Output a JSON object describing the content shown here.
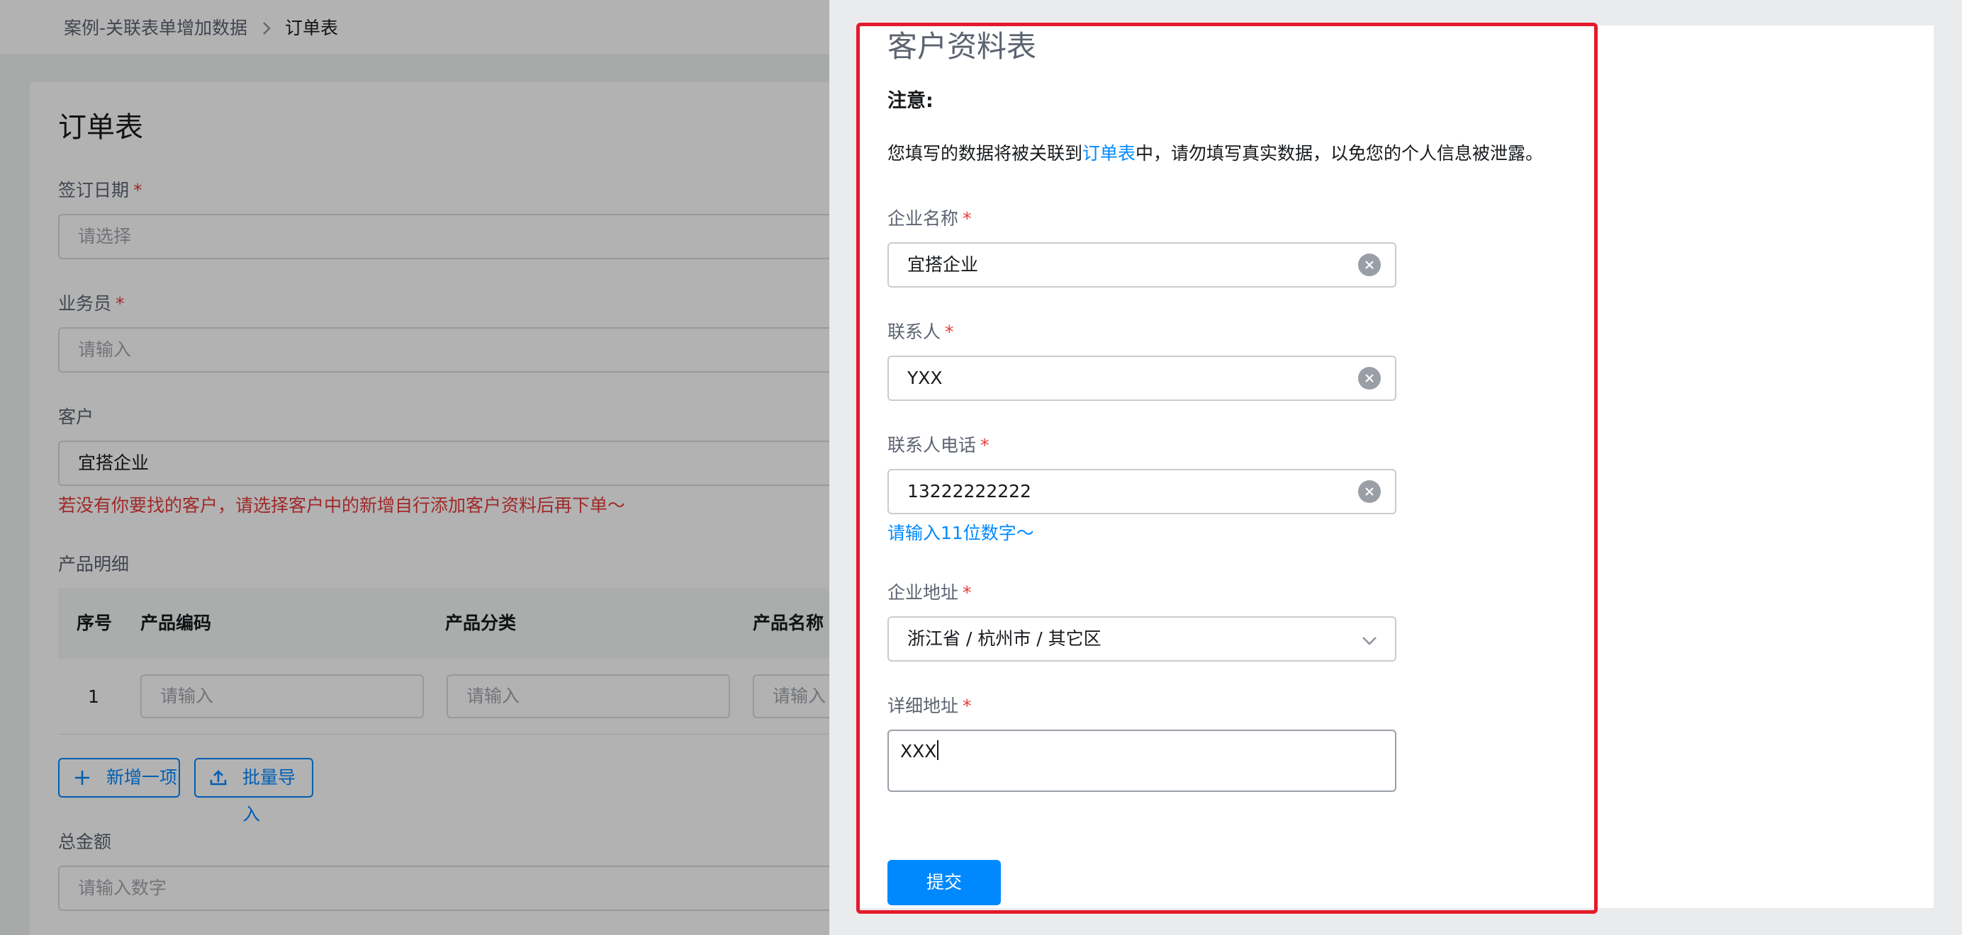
{
  "breadcrumb": {
    "parent": "案例-关联表单增加数据",
    "current": "订单表"
  },
  "order_form": {
    "title": "订单表",
    "fields": [
      {
        "label": "签订日期",
        "required": true,
        "placeholder": "请选择",
        "value": ""
      },
      {
        "label": "业务员",
        "required": true,
        "placeholder": "请输入",
        "value": ""
      },
      {
        "label": "客户",
        "required": false,
        "placeholder": "",
        "value": "宜搭企业"
      }
    ],
    "customer_tip": "若没有你要找的客户，请选择客户中的新增自行添加客户资料后再下单～",
    "product_section_label": "产品明细",
    "table": {
      "columns": [
        "序号",
        "产品编码",
        "产品分类",
        "产品名称"
      ],
      "rows": [
        {
          "index": "1",
          "cells": [
            "请输入",
            "请输入",
            "请输入"
          ]
        }
      ]
    },
    "add_item_label": "新增一项",
    "batch_import_label": "批量导入",
    "total_label": "总金额",
    "total_placeholder": "请输入数字"
  },
  "customer_form": {
    "title": "客户资料表",
    "notice_title": "注意:",
    "notice_before": "您填写的数据将被关联到",
    "notice_link": "订单表",
    "notice_after": "中，请勿填写真实数据，以免您的个人信息被泄露。",
    "required_mark": "*",
    "fields": {
      "company_name": {
        "label": "企业名称",
        "value": "宜搭企业"
      },
      "contact": {
        "label": "联系人",
        "value": "YXX"
      },
      "contact_phone": {
        "label": "联系人电话",
        "value": "13222222222",
        "hint": "请输入11位数字～"
      },
      "company_address": {
        "label": "企业地址",
        "value": "浙江省 / 杭州市 / 其它区"
      },
      "detail_address": {
        "label": "详细地址",
        "value": "XXX"
      }
    },
    "submit_label": "提交"
  },
  "colors": {
    "accent": "#0089ff",
    "required": "#e63c3c",
    "highlight_border": "#e31b2c"
  }
}
